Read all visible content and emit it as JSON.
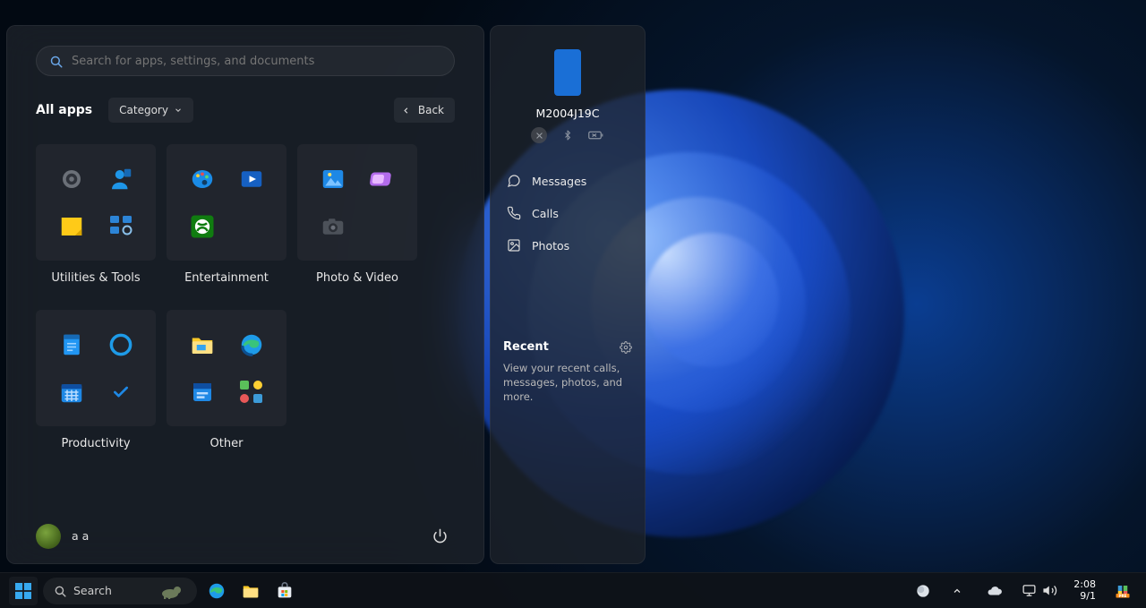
{
  "search": {
    "placeholder": "Search for apps, settings, and documents"
  },
  "allapps_label": "All apps",
  "category_chip": "Category",
  "back_label": "Back",
  "categories": [
    {
      "id": "utilities",
      "label": "Utilities & Tools"
    },
    {
      "id": "entertainment",
      "label": "Entertainment"
    },
    {
      "id": "photovideo",
      "label": "Photo & Video"
    },
    {
      "id": "productivity",
      "label": "Productivity"
    },
    {
      "id": "other",
      "label": "Other"
    }
  ],
  "user": {
    "name": "a a"
  },
  "phone": {
    "device_name": "M2004J19C",
    "items": [
      {
        "id": "messages",
        "label": "Messages"
      },
      {
        "id": "calls",
        "label": "Calls"
      },
      {
        "id": "photos",
        "label": "Photos"
      }
    ],
    "recent_title": "Recent",
    "recent_body": "View your recent calls, messages, photos, and more."
  },
  "taskbar": {
    "search_label": "Search",
    "clock_time": "2:08",
    "clock_date": "9/1"
  }
}
